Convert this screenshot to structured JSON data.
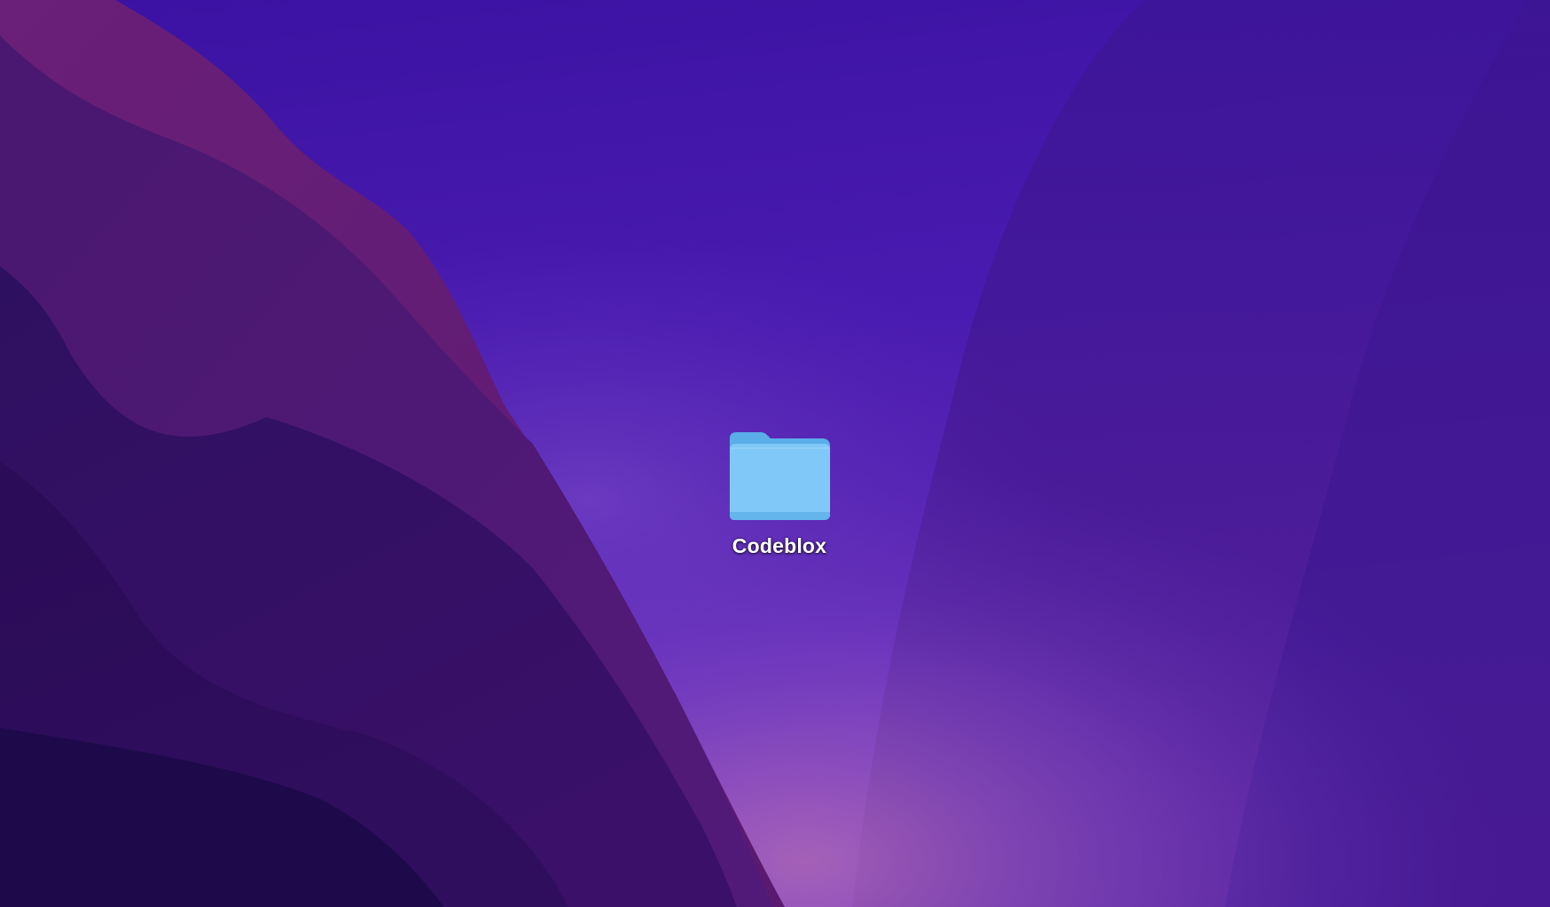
{
  "screen": {
    "type": "desktop",
    "wallpaper_colors": {
      "sky_top": "#3912a0",
      "sky_glow": "#8a4fc4",
      "ridge_dark": "#1c0a48",
      "ridge_mid": "#3a1268",
      "ridge_magenta": "#5e1a6e",
      "right_slope": "#4a1a9a"
    }
  },
  "desktop": {
    "items": [
      {
        "label": "Codeblox",
        "icon": "folder-icon",
        "icon_color": "#7fc8f8",
        "icon_tab_color": "#5aaee8"
      }
    ]
  }
}
